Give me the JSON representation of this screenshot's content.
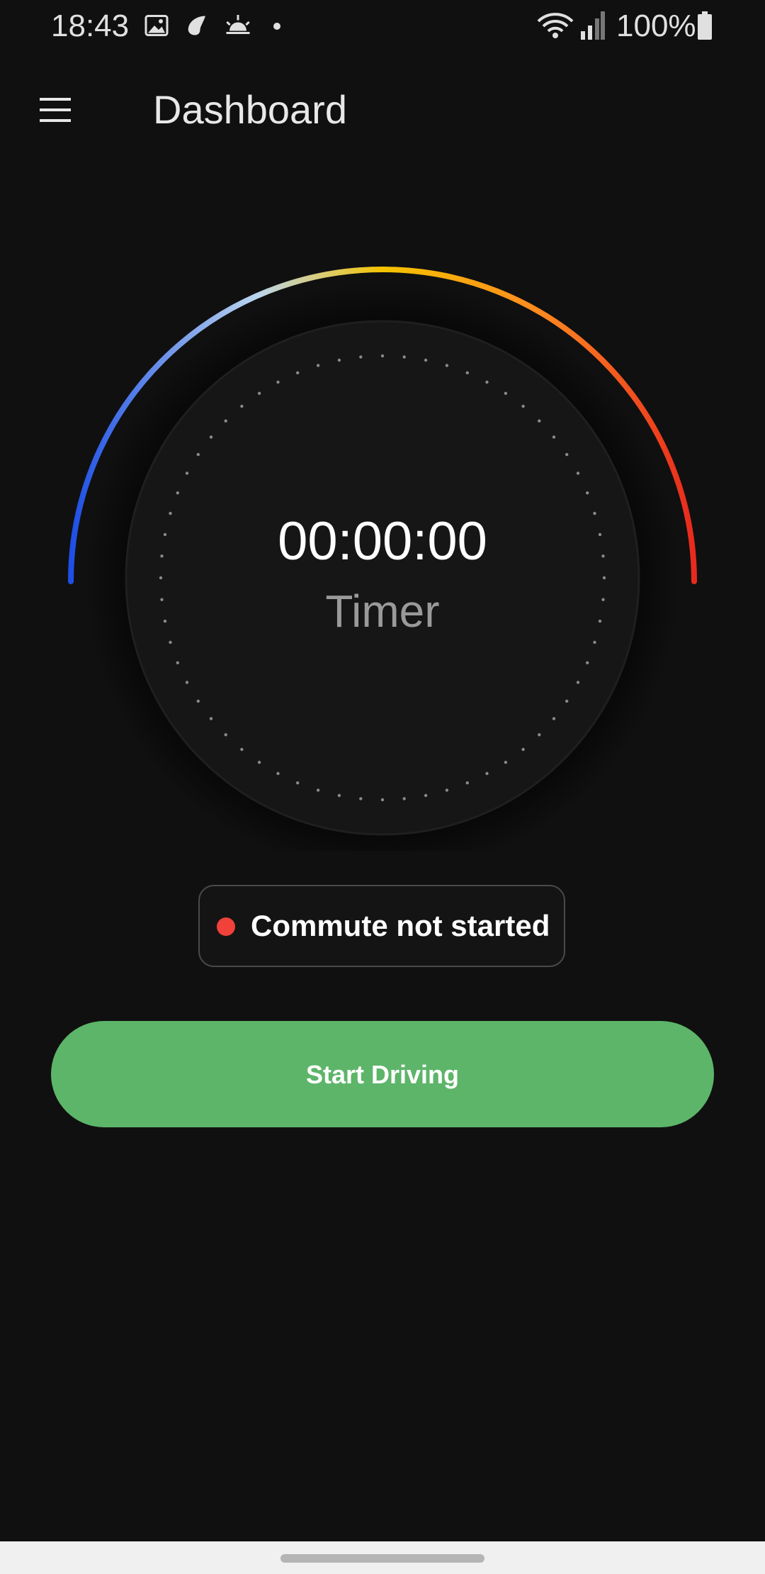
{
  "status_bar": {
    "time": "18:43",
    "battery": "100%",
    "left_icons": [
      "image-icon",
      "cloud-leaf-icon",
      "sunrise-icon",
      "dot-icon"
    ],
    "right_icons": [
      "wifi-icon",
      "signal-icon",
      "battery-icon"
    ]
  },
  "app_bar": {
    "title": "Dashboard",
    "menu_icon": "hamburger-menu-icon"
  },
  "timer": {
    "value": "00:00:00",
    "label": "Timer"
  },
  "commute_status": {
    "text": "Commute not started",
    "dot_color": "#f0413a"
  },
  "start_button": {
    "label": "Start Driving",
    "color": "#5db569"
  },
  "colors": {
    "background": "#101010",
    "dial_face": "#161616",
    "arc_gradient": [
      "#1e4fe6",
      "#bcd5ee",
      "#f5c400",
      "#e82a1e"
    ]
  }
}
